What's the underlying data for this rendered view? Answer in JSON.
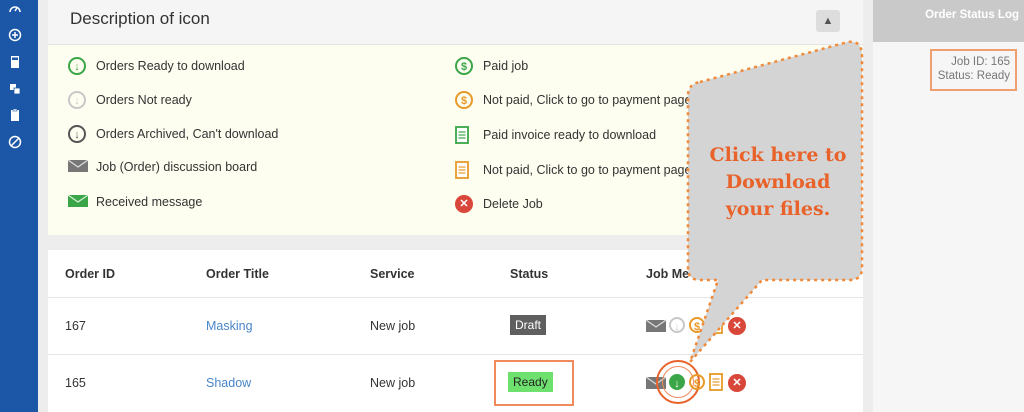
{
  "sidebar": {
    "icons": [
      "speedometer-icon",
      "add-circle-icon",
      "calculator-icon",
      "squares-icon",
      "clipboard-icon",
      "no-entry-icon"
    ]
  },
  "description": {
    "title": "Description of icon",
    "left_items": [
      {
        "icon": "download-ready-icon",
        "label": "Orders Ready to download"
      },
      {
        "icon": "download-not-ready-icon",
        "label": "Orders Not ready"
      },
      {
        "icon": "download-archived-icon",
        "label": "Orders Archived, Can't download"
      },
      {
        "icon": "envelope-gray-icon",
        "label": "Job (Order) discussion board"
      },
      {
        "icon": "envelope-green-icon",
        "label": "Received message"
      }
    ],
    "right_items": [
      {
        "icon": "dollar-paid-icon",
        "label": "Paid job"
      },
      {
        "icon": "dollar-unpaid-icon",
        "label": "Not paid, Click to go to payment page"
      },
      {
        "icon": "invoice-paid-icon",
        "label": "Paid invoice ready to download"
      },
      {
        "icon": "invoice-unpaid-icon",
        "label": "Not paid, Click to go to payment page"
      },
      {
        "icon": "delete-icon",
        "label": "Delete Job"
      }
    ]
  },
  "table": {
    "headers": [
      "Order ID",
      "Order Title",
      "Service",
      "Status",
      "Job Me"
    ],
    "rows": [
      {
        "id": "167",
        "title": "Masking",
        "service": "New job",
        "status": "Draft"
      },
      {
        "id": "165",
        "title": "Shadow",
        "service": "New job",
        "status": "Ready"
      }
    ]
  },
  "right_panel": {
    "title": "Order Status Log",
    "job_line": "Job ID: 165",
    "status_line": "Status: Ready"
  },
  "callout": {
    "line1": "Click here to",
    "line2": "Download",
    "line3": "your files."
  },
  "colors": {
    "sidebar": "#1b57a6",
    "green": "#3aa648",
    "orange": "#e89a28",
    "red": "#d9473a",
    "callout_text": "#e8622a",
    "callout_border": "#f08a3a"
  }
}
